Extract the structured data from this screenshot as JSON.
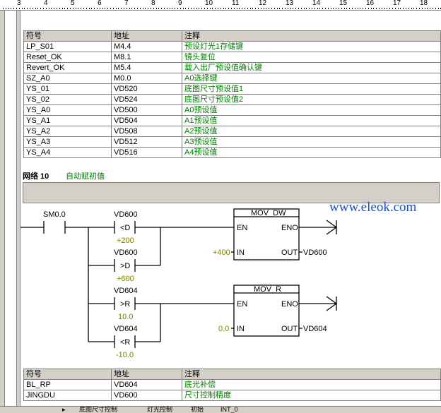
{
  "ruler": {
    "labels": [
      "3",
      "4",
      "5",
      "6",
      "7",
      "8",
      "9",
      "10",
      "11",
      "12",
      "13",
      "14",
      "15",
      "16",
      "17",
      "18"
    ]
  },
  "symbols_top": {
    "headers": [
      "符号",
      "地址",
      "注释"
    ],
    "rows": [
      [
        "LP_S01",
        "M4.4",
        "预设灯光1存储键"
      ],
      [
        "Reset_OK",
        "M8.1",
        "镜头复位"
      ],
      [
        "Revert_OK",
        "M5.4",
        "载入出厂预设值确认键"
      ],
      [
        "SZ_A0",
        "M0.0",
        "A0选择键"
      ],
      [
        "YS_01",
        "VD520",
        "底图尺寸预设值1"
      ],
      [
        "YS_02",
        "VD524",
        "底图尺寸预设值2"
      ],
      [
        "YS_A0",
        "VD500",
        "A0预设值"
      ],
      [
        "YS_A1",
        "VD504",
        "A1预设值"
      ],
      [
        "YS_A2",
        "VD508",
        "A2预设值"
      ],
      [
        "YS_A3",
        "VD512",
        "A3预设值"
      ],
      [
        "YS_A4",
        "VD516",
        "A4预设值"
      ]
    ]
  },
  "network": {
    "title": "网络 10",
    "comment": "自动赋初值"
  },
  "ladder": {
    "sm_contact": "SM0.0",
    "compare": [
      {
        "top": "VD600",
        "op": "<D",
        "bottom": "+200"
      },
      {
        "top": "VD600",
        "op": ">D",
        "bottom": "+600"
      },
      {
        "top": "VD604",
        "op": ">R",
        "bottom": "10.0"
      },
      {
        "top": "VD604",
        "op": "<R",
        "bottom": "-10.0"
      }
    ],
    "boxes": [
      {
        "name": "MOV_DW",
        "en": "EN",
        "eno": "ENO",
        "in": "IN",
        "out": "OUT",
        "in_val": "+400",
        "out_val": "VD600"
      },
      {
        "name": "MOV_R",
        "en": "EN",
        "eno": "ENO",
        "in": "IN",
        "out": "OUT",
        "in_val": "0.0",
        "out_val": "VD604"
      }
    ]
  },
  "watermark": "www.eleok.com",
  "symbols_bottom": {
    "headers": [
      "符号",
      "地址",
      "注释"
    ],
    "rows": [
      [
        "BL_RP",
        "VD604",
        "底光补偿"
      ],
      [
        "JINGDU",
        "VD600",
        "尺寸控制精度"
      ]
    ]
  },
  "tabs": [
    "底图尺寸控制",
    "灯光控制",
    "初始",
    "INT_0"
  ]
}
